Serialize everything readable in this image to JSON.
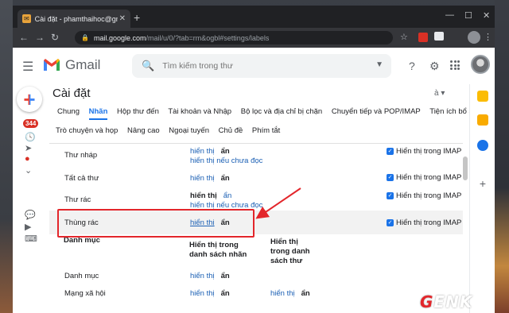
{
  "browser": {
    "tab_title": "Cài đặt - phamthaihoc@gmail.co",
    "url_host": "mail.google.com",
    "url_path": "/mail/u/0/?tab=rm&ogbl#settings/labels"
  },
  "gmail": {
    "logo_text": "Gmail",
    "search_placeholder": "Tìm kiếm trong thư",
    "unread_badge": "344"
  },
  "settings": {
    "title": "Cài đặt",
    "tabs_row1": [
      "Chung",
      "Nhãn",
      "Hộp thư đến",
      "Tài khoản và Nhập",
      "Bộ lọc và địa chỉ bị chặn",
      "Chuyển tiếp và POP/IMAP",
      "Tiện ích bổ sung"
    ],
    "tabs_row2": [
      "Trò chuyện và họp",
      "Nâng cao",
      "Ngoại tuyến",
      "Chủ đề",
      "Phím tắt"
    ],
    "active_tab": "Nhãn",
    "rows": [
      {
        "name": "Thư nháp",
        "show": "hiển thị",
        "hide": "ẩn",
        "unread": "hiển thị nếu chưa đọc",
        "imap": "Hiển thị trong IMAP"
      },
      {
        "name": "Tất cả thư",
        "show": "hiển thị",
        "hide": "ẩn",
        "imap": "Hiển thị trong IMAP"
      },
      {
        "name": "Thư rác",
        "show": "hiển thị",
        "hide": "ẩn",
        "unread": "hiển thị nếu chưa đọc",
        "imap": "Hiển thị trong IMAP"
      },
      {
        "name": "Thùng rác",
        "show": "hiển thị",
        "hide": "ẩn",
        "imap": "Hiển thị trong IMAP"
      }
    ],
    "categories": {
      "header": "Danh mục",
      "col_label_list": "Hiển thị trong danh sách nhãn",
      "col_message_list": "Hiển thị trong danh sách thư",
      "items": [
        {
          "name": "Danh mục",
          "show": "hiển thị",
          "hide": "ẩn"
        },
        {
          "name": "Mạng xã hội",
          "show": "hiển thị",
          "hide": "ẩn",
          "show2": "hiển thị",
          "hide2": "ẩn"
        }
      ]
    }
  },
  "watermark": "GENK"
}
